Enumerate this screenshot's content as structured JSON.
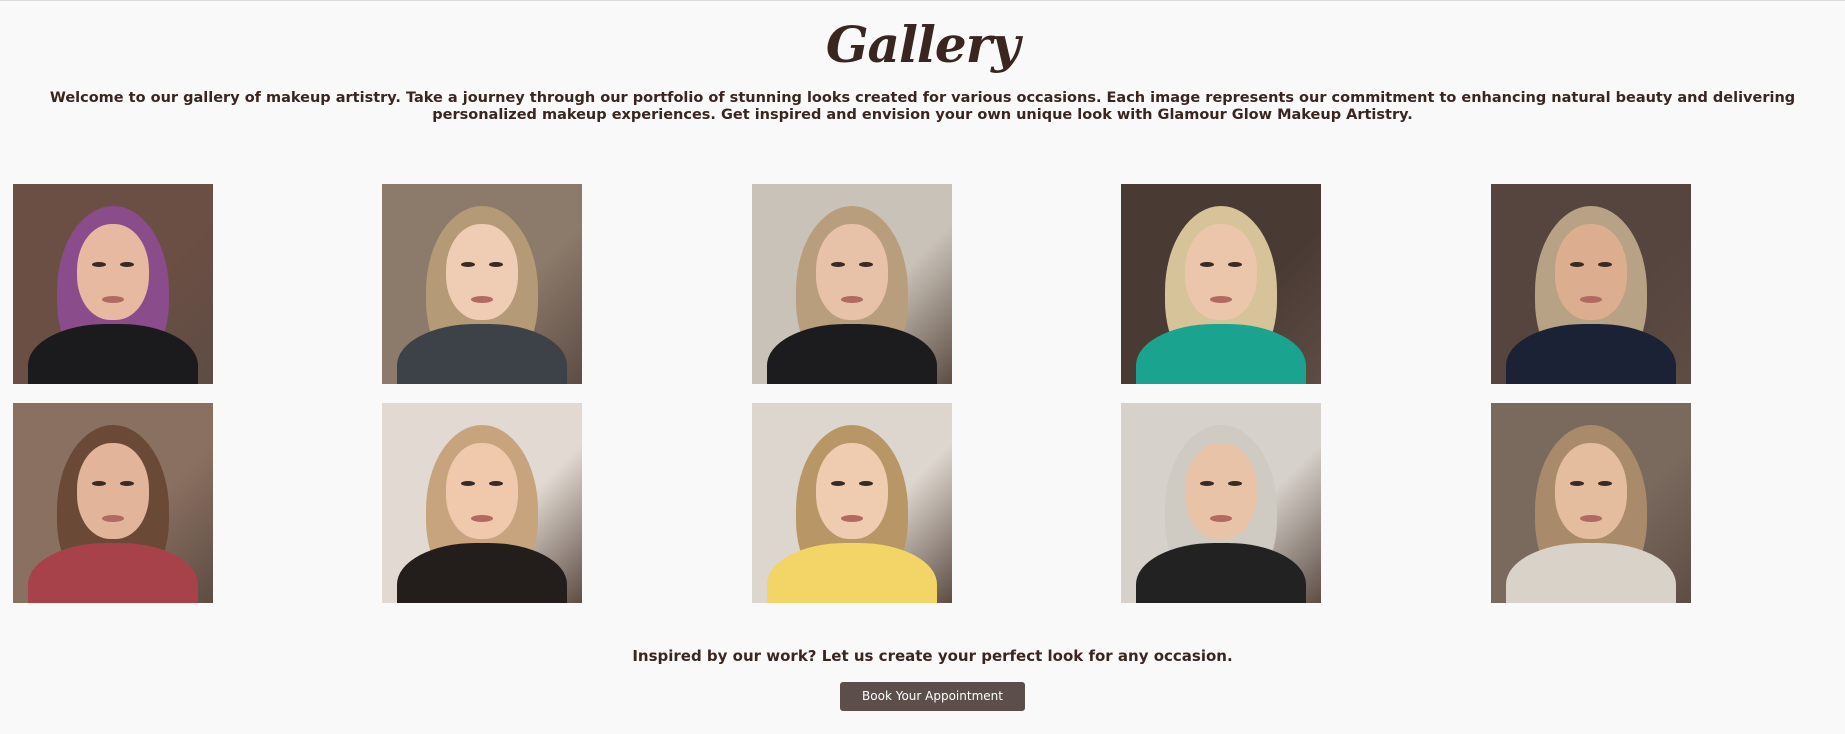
{
  "gallery": {
    "title": "Gallery",
    "intro": "Welcome to our gallery of makeup artistry. Take a journey through our portfolio of stunning looks created for various occasions. Each image represents our commitment to enhancing natural beauty and delivering personalized makeup experiences. Get inspired and envision your own unique look with Glamour Glow Makeup Artistry.",
    "images": [
      {
        "name": "gallery-photo-1",
        "bg": "#6b4e44",
        "hair": "#8a4c8a",
        "skin": "#e6b9a0",
        "top": "#1b1b1e"
      },
      {
        "name": "gallery-photo-2",
        "bg": "#8c7a6a",
        "hair": "#b49a76",
        "skin": "#efcdb5",
        "top": "#3d4148"
      },
      {
        "name": "gallery-photo-3",
        "bg": "#c9c2b8",
        "hair": "#b89e7c",
        "skin": "#e8c2a8",
        "top": "#1c1c1e"
      },
      {
        "name": "gallery-photo-4",
        "bg": "#4a3a34",
        "hair": "#d7c39a",
        "skin": "#ecc6ab",
        "top": "#1aa38e"
      },
      {
        "name": "gallery-photo-5",
        "bg": "#56443e",
        "hair": "#b7a285",
        "skin": "#dcae8f",
        "top": "#1b2236"
      },
      {
        "name": "gallery-photo-6",
        "bg": "#8a7060",
        "hair": "#6a4a36",
        "skin": "#e2b59a",
        "top": "#a8424a"
      },
      {
        "name": "gallery-photo-7",
        "bg": "#e2dad2",
        "hair": "#c7a47e",
        "skin": "#f0c9ad",
        "top": "#231d1c"
      },
      {
        "name": "gallery-photo-8",
        "bg": "#ddd6ce",
        "hair": "#b99665",
        "skin": "#efcbb0",
        "top": "#f2d566"
      },
      {
        "name": "gallery-photo-9",
        "bg": "#d6d1ca",
        "hair": "#cfcac2",
        "skin": "#e9c3a8",
        "top": "#222222"
      },
      {
        "name": "gallery-photo-10",
        "bg": "#7a6a5e",
        "hair": "#a98a6a",
        "skin": "#e4bc9e",
        "top": "#d8d2c8"
      }
    ]
  },
  "cta": {
    "text": "Inspired by our work? Let us create your perfect look for any occasion.",
    "button_label": "Book Your Appointment"
  }
}
